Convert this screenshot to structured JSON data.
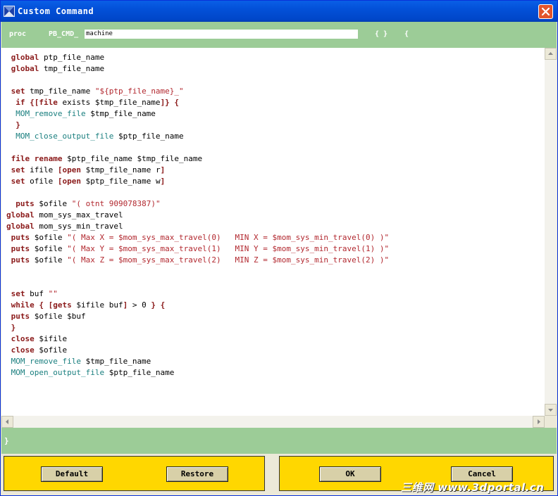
{
  "window": {
    "title": "Custom Command"
  },
  "proc": {
    "keyword": "proc",
    "prefix": "PB_CMD_",
    "name_value": "machine",
    "args": "{ }",
    "open_brace": "{"
  },
  "code_lines": [
    [
      {
        "t": " global",
        "c": "kw"
      },
      {
        "t": " ptp_file_name"
      }
    ],
    [
      {
        "t": " global",
        "c": "kw"
      },
      {
        "t": " tmp_file_name"
      }
    ],
    [],
    [
      {
        "t": " set",
        "c": "kw"
      },
      {
        "t": " tmp_file_name "
      },
      {
        "t": "\"${ptp_file_name}_\"",
        "c": "str"
      }
    ],
    [
      {
        "t": "  if {[file",
        "c": "kw"
      },
      {
        "t": " exists $tmp_file_name"
      },
      {
        "t": "]} {",
        "c": "kw"
      }
    ],
    [
      {
        "t": "  MOM_remove_file",
        "c": "mom"
      },
      {
        "t": " $tmp_file_name"
      }
    ],
    [
      {
        "t": "  }",
        "c": "kw"
      }
    ],
    [
      {
        "t": "  MOM_close_output_file",
        "c": "mom"
      },
      {
        "t": " $ptp_file_name"
      }
    ],
    [],
    [
      {
        "t": " file rename",
        "c": "kw"
      },
      {
        "t": " $ptp_file_name $tmp_file_name"
      }
    ],
    [
      {
        "t": " set",
        "c": "kw"
      },
      {
        "t": " ifile "
      },
      {
        "t": "[open",
        "c": "kw"
      },
      {
        "t": " $tmp_file_name r"
      },
      {
        "t": "]",
        "c": "kw"
      }
    ],
    [
      {
        "t": " set",
        "c": "kw"
      },
      {
        "t": " ofile "
      },
      {
        "t": "[open",
        "c": "kw"
      },
      {
        "t": " $ptp_file_name w"
      },
      {
        "t": "]",
        "c": "kw"
      }
    ],
    [],
    [
      {
        "t": "  puts",
        "c": "kw"
      },
      {
        "t": " $ofile "
      },
      {
        "t": "\"( otnt 909078387)\"",
        "c": "str"
      }
    ],
    [
      {
        "t": "global",
        "c": "kw"
      },
      {
        "t": " mom_sys_max_travel"
      }
    ],
    [
      {
        "t": "global",
        "c": "kw"
      },
      {
        "t": " mom_sys_min_travel"
      }
    ],
    [
      {
        "t": " puts",
        "c": "kw"
      },
      {
        "t": " $ofile "
      },
      {
        "t": "\"( Max X = $mom_sys_max_travel(0)   MIN X = $mom_sys_min_travel(0) )\"",
        "c": "str"
      }
    ],
    [
      {
        "t": " puts",
        "c": "kw"
      },
      {
        "t": " $ofile "
      },
      {
        "t": "\"( Max Y = $mom_sys_max_travel(1)   MIN Y = $mom_sys_min_travel(1) )\"",
        "c": "str"
      }
    ],
    [
      {
        "t": " puts",
        "c": "kw"
      },
      {
        "t": " $ofile "
      },
      {
        "t": "\"( Max Z = $mom_sys_max_travel(2)   MIN Z = $mom_sys_min_travel(2) )\"",
        "c": "str"
      }
    ],
    [],
    [],
    [
      {
        "t": " set",
        "c": "kw"
      },
      {
        "t": " buf "
      },
      {
        "t": "\"\"",
        "c": "str"
      }
    ],
    [
      {
        "t": " while { [gets",
        "c": "kw"
      },
      {
        "t": " $ifile buf"
      },
      {
        "t": "]",
        "c": "kw"
      },
      {
        "t": " > 0 "
      },
      {
        "t": "} {",
        "c": "kw"
      }
    ],
    [
      {
        "t": " puts",
        "c": "kw"
      },
      {
        "t": " $ofile $buf"
      }
    ],
    [
      {
        "t": " }",
        "c": "kw"
      }
    ],
    [
      {
        "t": " close",
        "c": "kw"
      },
      {
        "t": " $ifile"
      }
    ],
    [
      {
        "t": " close",
        "c": "kw"
      },
      {
        "t": " $ofile"
      }
    ],
    [
      {
        "t": " MOM_remove_file",
        "c": "mom"
      },
      {
        "t": " $tmp_file_name"
      }
    ],
    [
      {
        "t": " MOM_open_output_file",
        "c": "mom"
      },
      {
        "t": " $ptp_file_name"
      }
    ]
  ],
  "status": {
    "closing_brace": "}"
  },
  "buttons": {
    "default": "Default",
    "restore": "Restore",
    "ok": "OK",
    "cancel": "Cancel"
  },
  "watermark": "三维网 www.3dportal.cn",
  "colors": {
    "titlebar": "#0350d8",
    "green_bar": "#9ccc97",
    "button_panel": "#ffd700",
    "keyword": "#8b1a1a",
    "string": "#b2282f",
    "mom_command": "#1a7f7f"
  }
}
